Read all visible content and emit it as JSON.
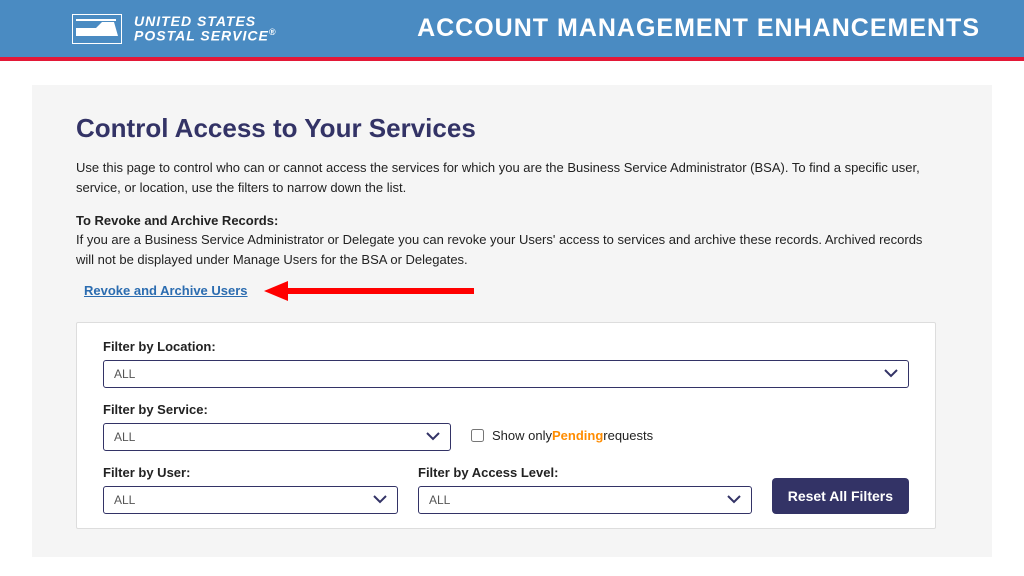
{
  "header": {
    "logo_line1": "UNITED STATES",
    "logo_line2": "POSTAL SERVICE",
    "title": "ACCOUNT MANAGEMENT ENHANCEMENTS"
  },
  "main": {
    "page_title": "Control Access to Your Services",
    "intro": "Use this page to control who can or cannot access the services for which you are the Business Service Administrator (BSA). To find a specific user, service, or location, use the filters to narrow down the list.",
    "revoke_heading": "To Revoke and Archive Records:",
    "revoke_body": "If you are a Business Service Administrator or Delegate you can revoke your Users' access to services and archive these records. Archived records will not be displayed under Manage Users for the BSA or Delegates.",
    "revoke_link": "Revoke and Archive Users"
  },
  "filters": {
    "location_label": "Filter by Location:",
    "location_value": "ALL",
    "service_label": "Filter by Service:",
    "service_value": "ALL",
    "user_label": "Filter by User:",
    "user_value": "ALL",
    "access_label": "Filter by Access Level:",
    "access_value": "ALL",
    "pending_prefix": "Show only ",
    "pending_word": "Pending",
    "pending_suffix": " requests",
    "reset_btn": "Reset All Filters"
  }
}
